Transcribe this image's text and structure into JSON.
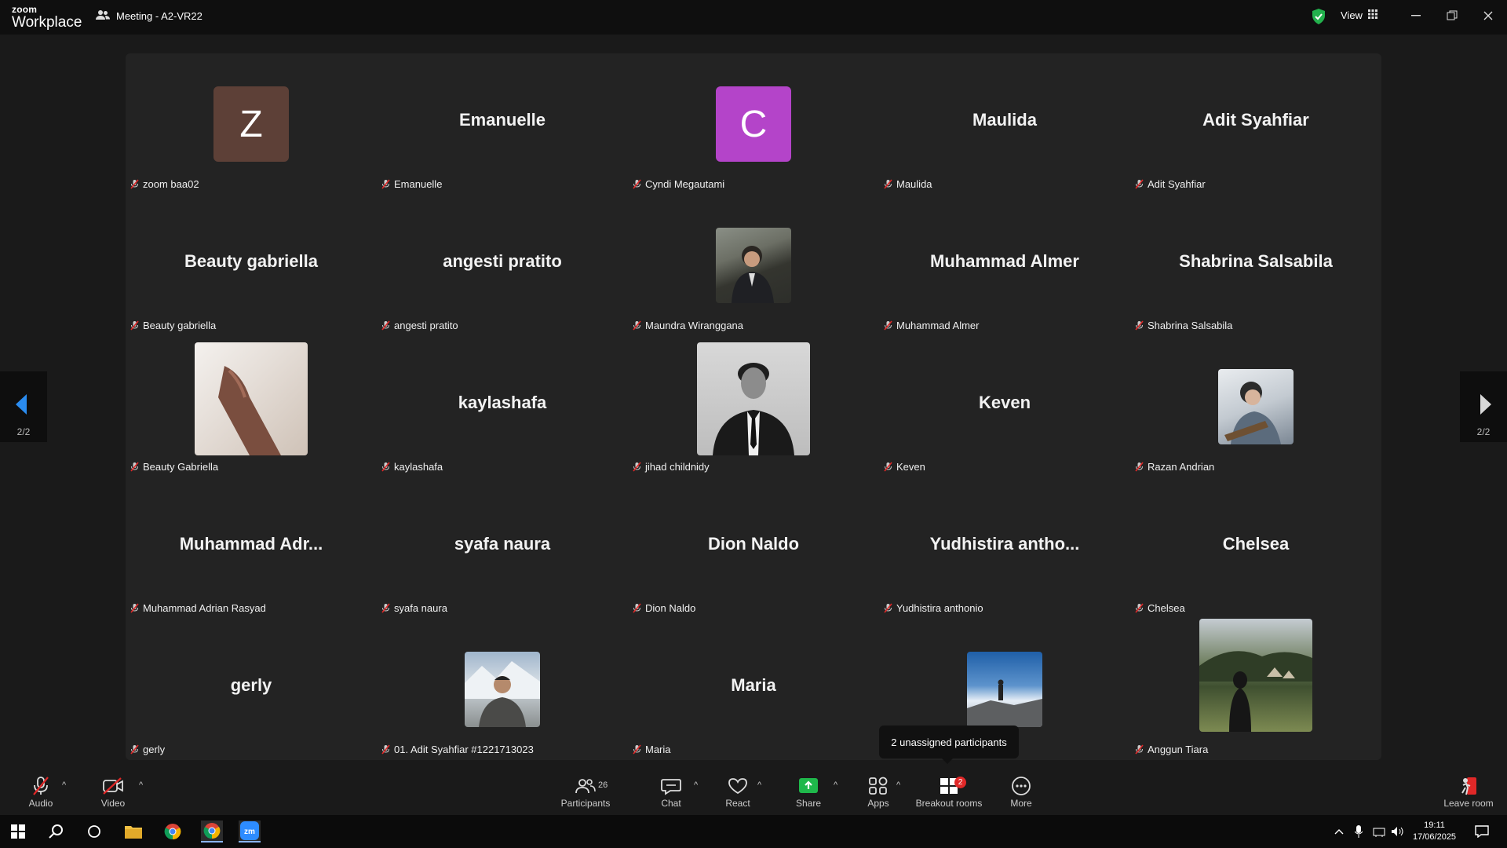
{
  "app": {
    "logo_line1": "zoom",
    "logo_line2": "Workplace",
    "meeting_title": "Meeting - A2-VR22",
    "view_label": "View"
  },
  "participants": [
    {
      "big": "",
      "label": "zoom baa02",
      "avatar": "Z",
      "avatar_color": "#5d4037"
    },
    {
      "big": "Emanuelle",
      "label": "Emanuelle"
    },
    {
      "big": "",
      "label": "Cyndi Megautami",
      "avatar": "C",
      "avatar_color": "#b444c9"
    },
    {
      "big": "Maulida",
      "label": "Maulida"
    },
    {
      "big": "Adit Syahfiar",
      "label": "Adit Syahfiar"
    },
    {
      "big": "Beauty gabriella",
      "label": "Beauty gabriella"
    },
    {
      "big": "angesti pratito",
      "label": "angesti pratito"
    },
    {
      "big": "",
      "label": "Maundra Wiranggana",
      "photo": "maundra-photo"
    },
    {
      "big": "Muhammad Almer",
      "label": "Muhammad Almer"
    },
    {
      "big": "Shabrina Salsabila",
      "label": "Shabrina Salsabila"
    },
    {
      "big": "",
      "label": "Beauty Gabriella",
      "photo": "beauty-photo"
    },
    {
      "big": "kaylashafa",
      "label": "kaylashafa"
    },
    {
      "big": "",
      "label": "jihad childnidy",
      "photo": "jihad-photo"
    },
    {
      "big": "Keven",
      "label": "Keven"
    },
    {
      "big": "",
      "label": "Razan Andrian",
      "photo": "razan-photo"
    },
    {
      "big": "Muhammad  Adr...",
      "label": "Muhammad Adrian Rasyad"
    },
    {
      "big": "syafa naura",
      "label": "syafa naura"
    },
    {
      "big": "Dion Naldo",
      "label": "Dion Naldo"
    },
    {
      "big": "Yudhistira  antho...",
      "label": "Yudhistira anthonio"
    },
    {
      "big": "Chelsea",
      "label": "Chelsea"
    },
    {
      "big": "gerly",
      "label": "gerly"
    },
    {
      "big": "",
      "label": "01. Adit Syahfiar #1221713023",
      "photo": "adit-photo"
    },
    {
      "big": "Maria",
      "label": "Maria"
    },
    {
      "big": "",
      "label": "",
      "photo": "mountain-photo"
    },
    {
      "big": "",
      "label": "Anggun Tiara",
      "photo": "anggun-photo"
    }
  ],
  "pagination": {
    "left": "2/2",
    "right": "2/2"
  },
  "tooltip": "2 unassigned participants",
  "toolbar": {
    "audio": "Audio",
    "video": "Video",
    "participants": "Participants",
    "participants_count": "26",
    "chat": "Chat",
    "react": "React",
    "share": "Share",
    "apps": "Apps",
    "breakout": "Breakout rooms",
    "breakout_badge": "2",
    "more": "More",
    "leave": "Leave room"
  },
  "taskbar": {
    "time": "19:11",
    "date": "17/06/2025"
  },
  "colors": {
    "share_green": "#1fb84b",
    "muted_red": "#e02828",
    "nav_arrow": "#2a8cf0"
  }
}
